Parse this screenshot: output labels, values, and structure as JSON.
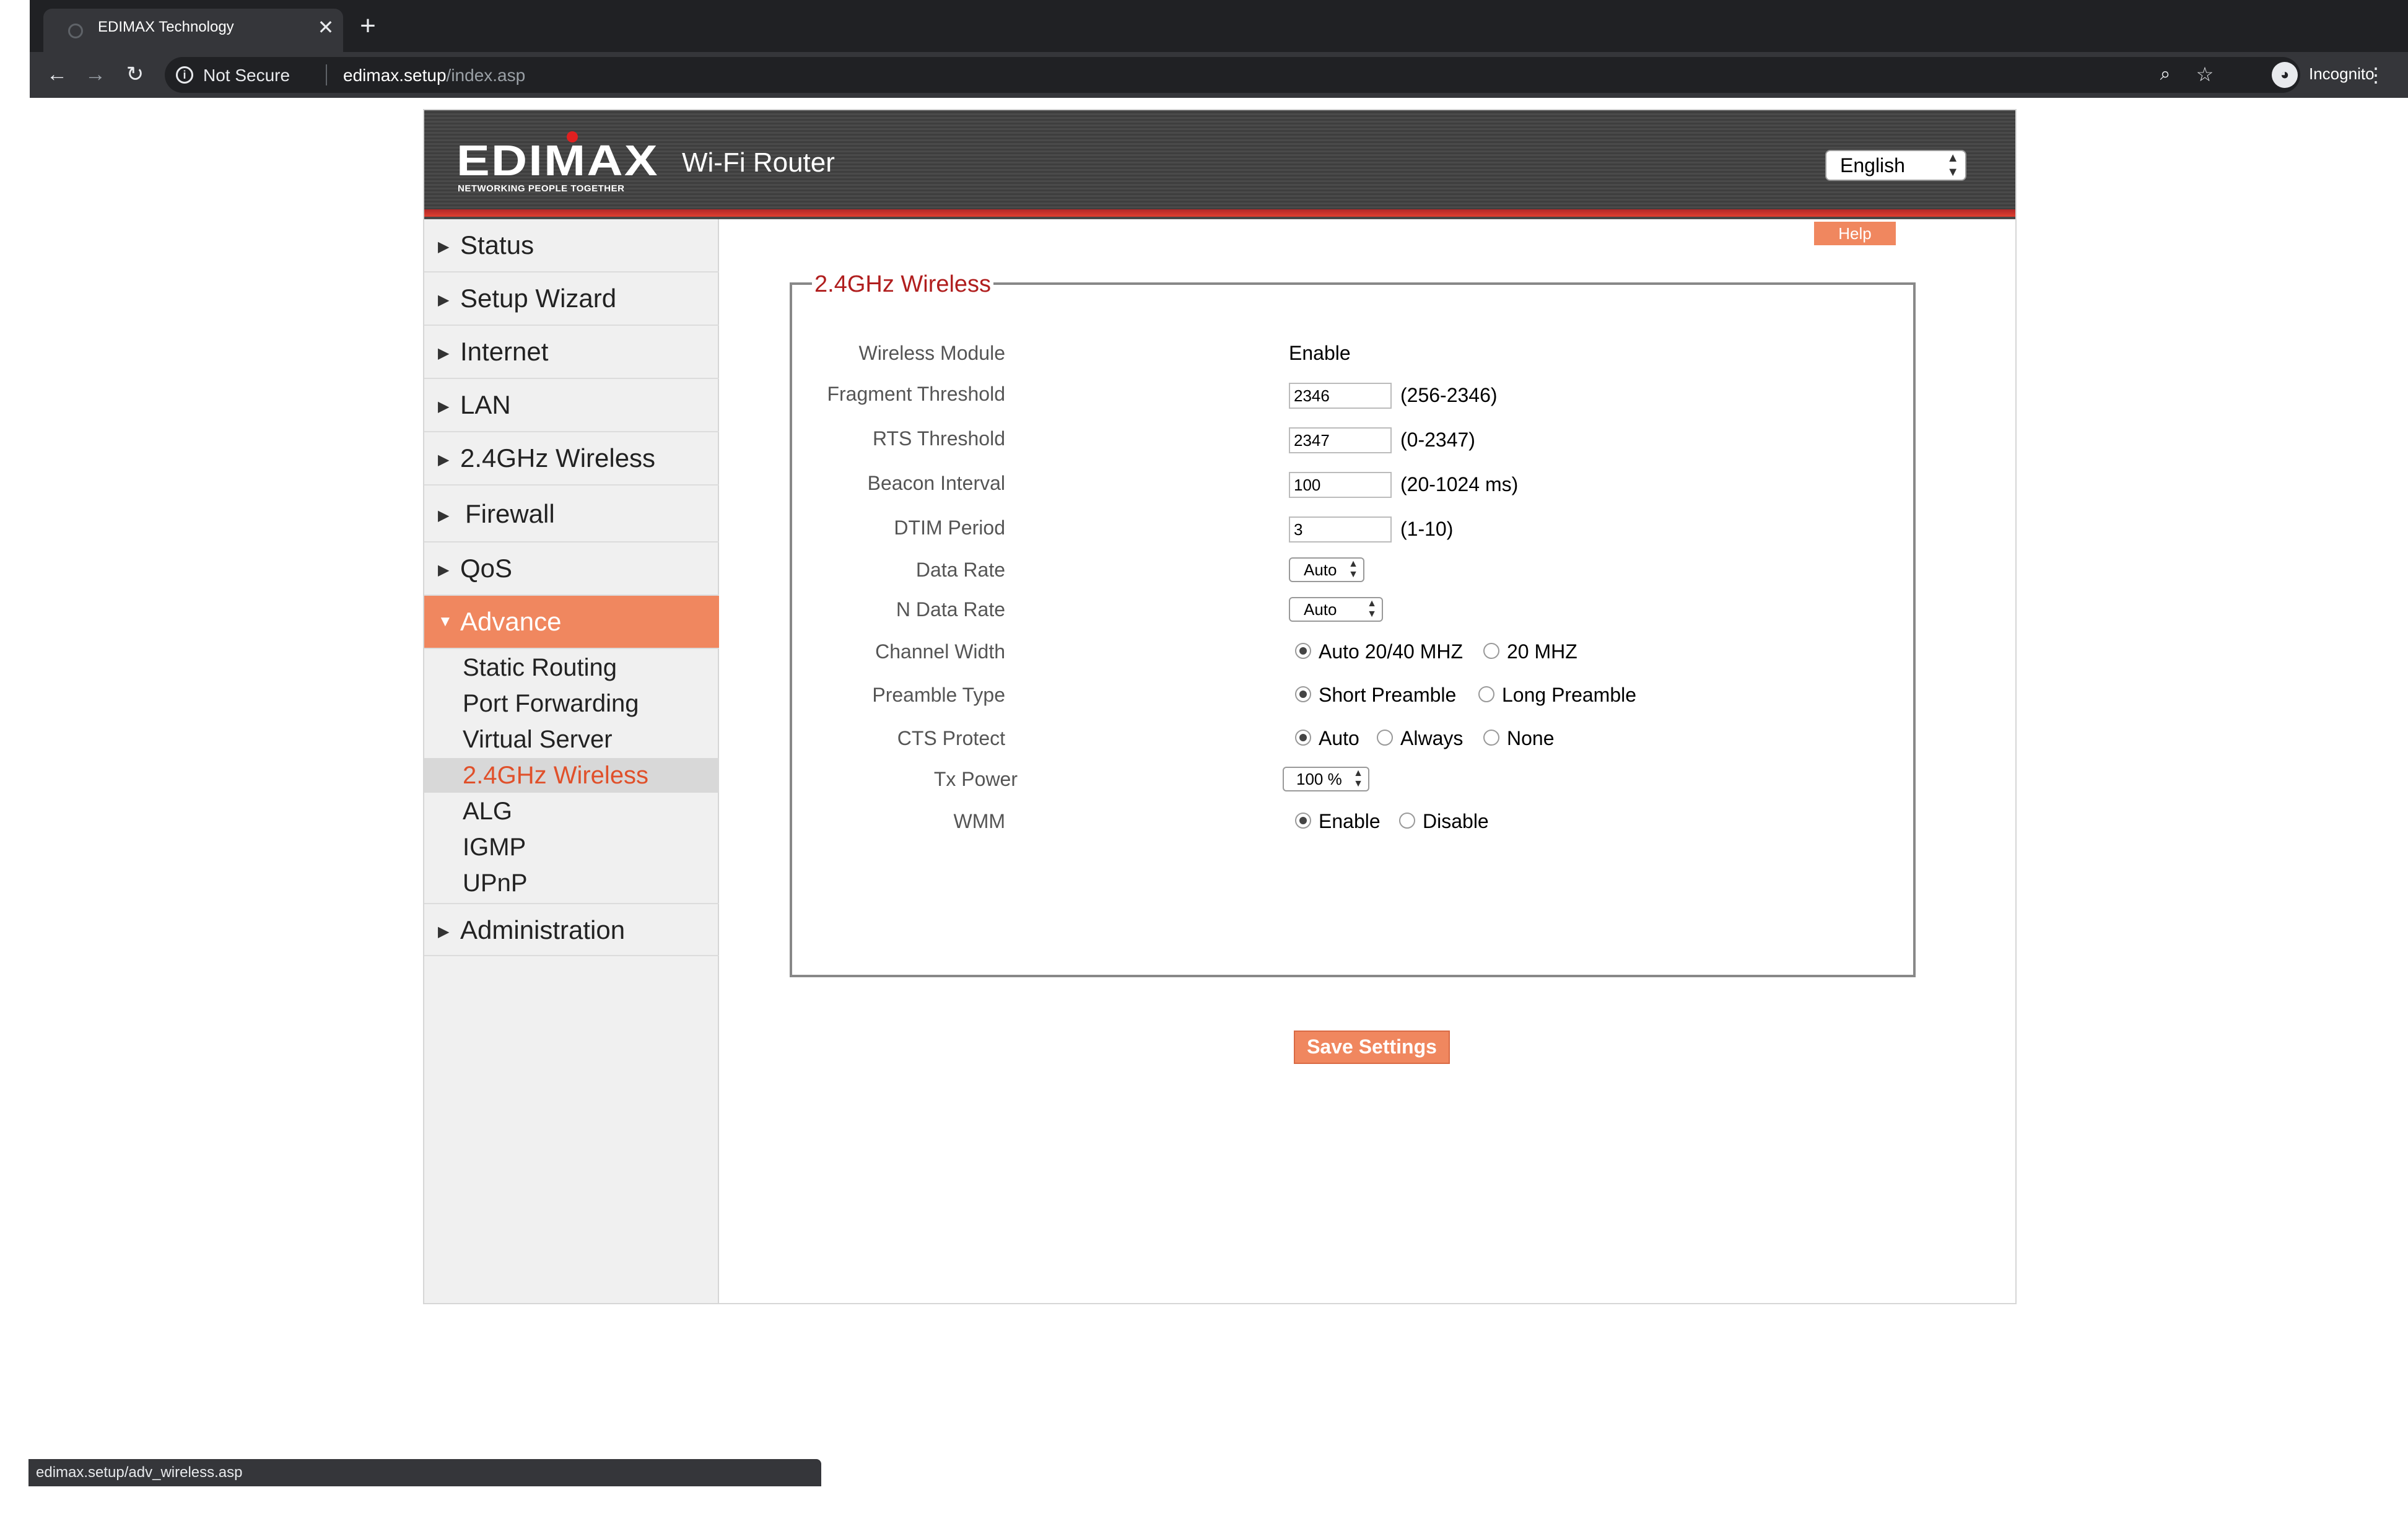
{
  "browser": {
    "tab_title": "EDIMAX Technology",
    "tab_close": "✕",
    "new_tab": "+",
    "security_label": "Not Secure",
    "url_host": "edimax.setup",
    "url_path": "/index.asp",
    "profile_label": "Incognito",
    "status_url": "edimax.setup/adv_wireless.asp"
  },
  "header": {
    "logo_text": "EDIMAX",
    "logo_tagline": "NETWORKING PEOPLE TOGETHER",
    "product_title": "Wi-Fi Router",
    "language": "English"
  },
  "sidebar": {
    "items": [
      {
        "label": "Status"
      },
      {
        "label": "Setup Wizard"
      },
      {
        "label": "Internet"
      },
      {
        "label": "LAN"
      },
      {
        "label": "2.4GHz Wireless"
      },
      {
        "label": "Firewall"
      },
      {
        "label": "QoS"
      },
      {
        "label": "Advance"
      },
      {
        "label": "Administration"
      }
    ],
    "submenu": [
      {
        "label": "Static Routing"
      },
      {
        "label": "Port Forwarding"
      },
      {
        "label": "Virtual Server"
      },
      {
        "label": "2.4GHz Wireless"
      },
      {
        "label": "ALG"
      },
      {
        "label": "IGMP"
      },
      {
        "label": "UPnP"
      }
    ],
    "arrow_closed": "▶",
    "arrow_open": "▼"
  },
  "main": {
    "help_label": "Help",
    "section_title": "2.4GHz Wireless",
    "wireless_module": {
      "label": "Wireless Module",
      "value": "Enable"
    },
    "fragment_threshold": {
      "label": "Fragment Threshold",
      "value": "2346",
      "hint": "(256-2346)"
    },
    "rts_threshold": {
      "label": "RTS Threshold",
      "value": "2347",
      "hint": "(0-2347)"
    },
    "beacon_interval": {
      "label": "Beacon Interval",
      "value": "100",
      "hint": "(20-1024 ms)"
    },
    "dtim_period": {
      "label": "DTIM Period",
      "value": "3",
      "hint": "(1-10)"
    },
    "data_rate": {
      "label": "Data Rate",
      "value": "Auto"
    },
    "n_data_rate": {
      "label": "N Data Rate",
      "value": "Auto"
    },
    "channel_width": {
      "label": "Channel Width",
      "options": [
        "Auto 20/40 MHZ",
        "20 MHZ"
      ],
      "selected": 0
    },
    "preamble_type": {
      "label": "Preamble Type",
      "options": [
        "Short Preamble",
        "Long Preamble"
      ],
      "selected": 0
    },
    "cts_protect": {
      "label": "CTS Protect",
      "options": [
        "Auto",
        "Always",
        "None"
      ],
      "selected": 0
    },
    "tx_power": {
      "label": "Tx Power",
      "value": "100 %"
    },
    "wmm": {
      "label": "WMM",
      "options": [
        "Enable",
        "Disable"
      ],
      "selected": 0
    },
    "save_label": "Save Settings"
  },
  "colors": {
    "accent": "#f0875f",
    "title_red": "#b01e1e",
    "current_text": "#e0502a"
  }
}
